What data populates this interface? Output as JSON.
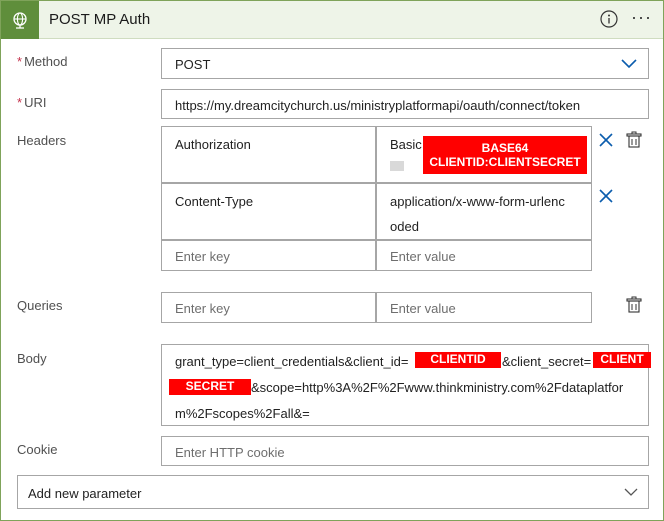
{
  "action": {
    "title": "POST MP Auth"
  },
  "fields": {
    "method": {
      "label": "Method",
      "required_mark": "*",
      "value": "POST"
    },
    "uri": {
      "label": "URI",
      "required_mark": "*",
      "value": "https://my.dreamcitychurch.us/ministryplatformapi/oauth/connect/token"
    },
    "headers": {
      "label": "Headers",
      "rows": [
        {
          "key": "Authorization",
          "value": "Basic",
          "redacted": [
            "BASE64",
            "CLIENTID:CLIENTSECRET"
          ]
        },
        {
          "key": "Content-Type",
          "value_line1": "application/x-www-form-urlenc",
          "value_line2": "oded"
        }
      ],
      "key_placeholder": "Enter key",
      "value_placeholder": "Enter value"
    },
    "queries": {
      "label": "Queries",
      "key_placeholder": "Enter key",
      "value_placeholder": "Enter value"
    },
    "body": {
      "label": "Body",
      "line1_a": "grant_type=client_credentials&client_id=",
      "redacted_clientid": "CLIENTID",
      "line1_b": "&client_secret=",
      "redacted_client": "CLIENT",
      "redacted_secret": "SECRET",
      "line2_b": "&scope=http%3A%2F%2Fwww.thinkministry.com%2Fdataplatfor",
      "line3": "m%2Fscopes%2Fall&="
    },
    "cookie": {
      "label": "Cookie",
      "placeholder": "Enter HTTP cookie"
    },
    "add_parameter": {
      "label": "Add new parameter"
    }
  },
  "colors": {
    "header_bg": "#eef4e8",
    "icon_bg": "#5f8e3b",
    "accent_blue": "#0b5cad",
    "redact": "#ff0000"
  }
}
